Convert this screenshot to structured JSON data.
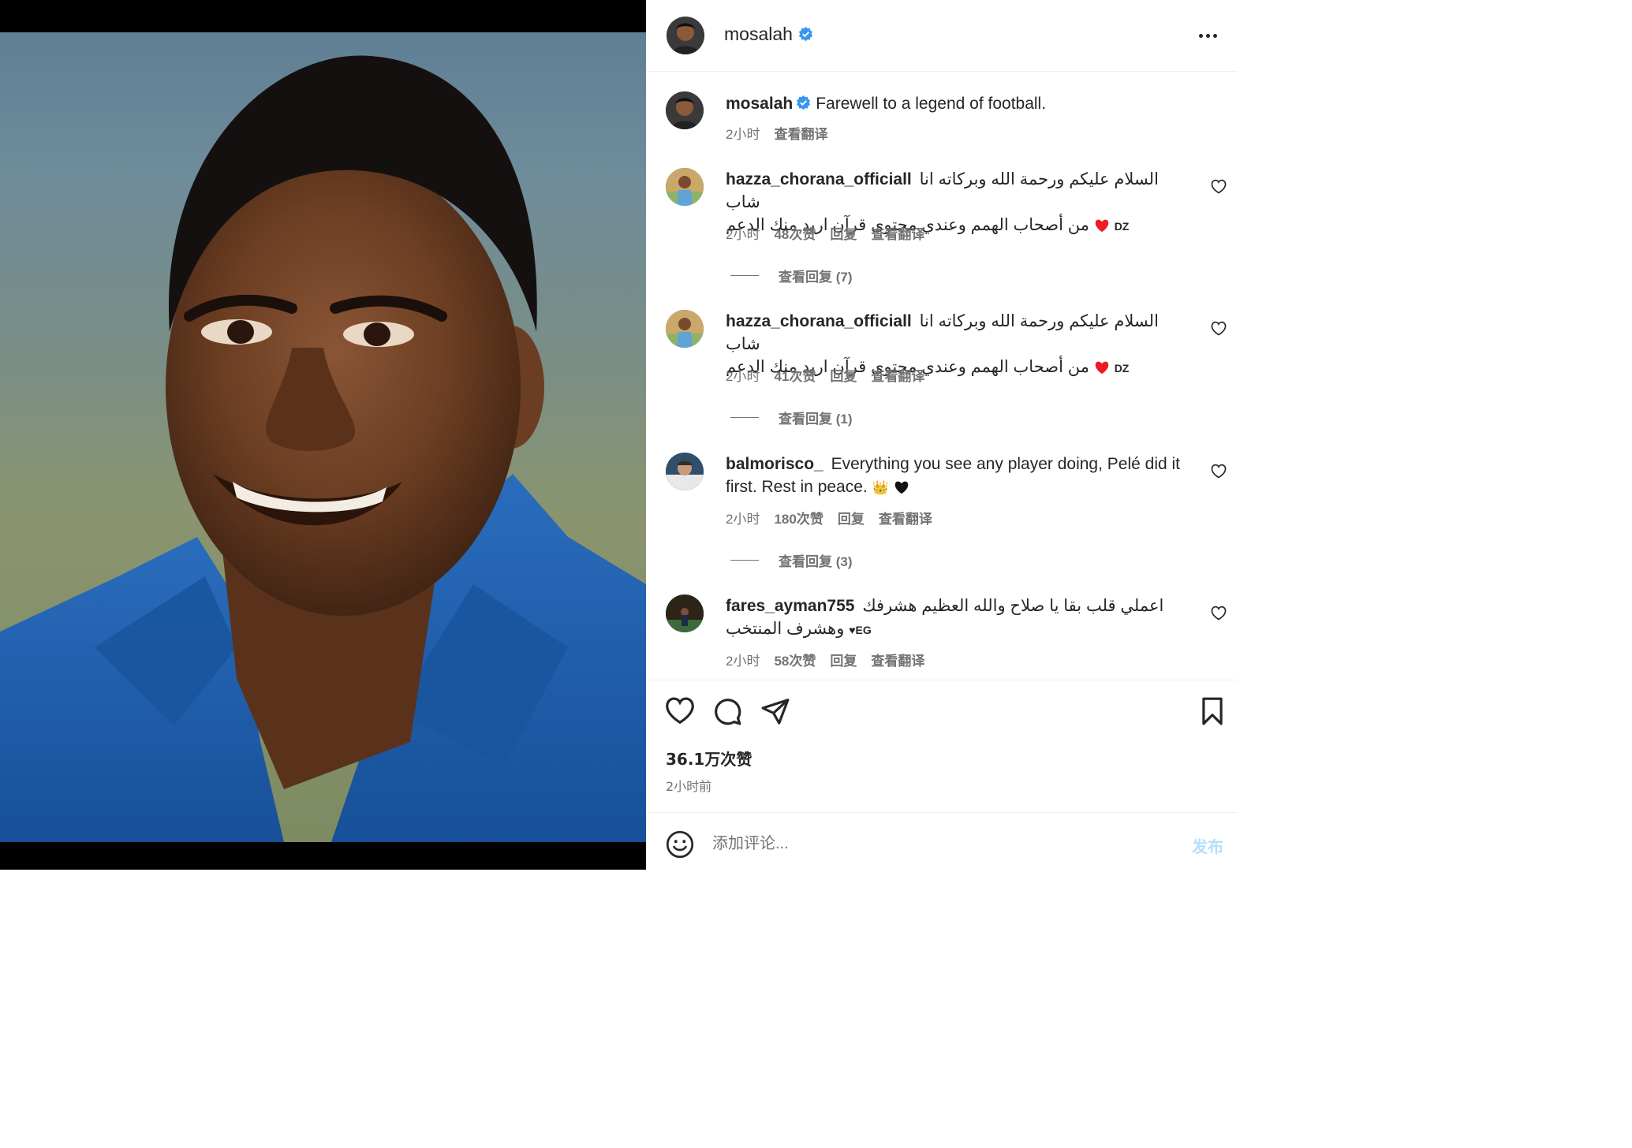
{
  "post": {
    "author": "mosalah",
    "verified": true,
    "caption": "Farewell to a legend of football.",
    "caption_time": "2小时",
    "caption_translate": "查看翻译",
    "photo_icon": "portrait-photo"
  },
  "comments": [
    {
      "username": "hazza_chorana_officiall",
      "text_line1": "السلام عليكم ورحمة الله وبركاته انا شاب",
      "text_line2": "من أصحاب الهمم وعندي محتوى قرآن اريد منك الدعم",
      "suffix": "DZ",
      "time": "2小时",
      "likes": "48次赞",
      "reply": "回复",
      "translate": "查看翻译",
      "view_replies": "查看回复 (7)"
    },
    {
      "username": "hazza_chorana_officiall",
      "text_line1": "السلام عليكم ورحمة الله وبركاته انا شاب",
      "text_line2": "من أصحاب الهمم وعندي محتوى قرآن اريد منك الدعم",
      "suffix": "DZ",
      "time": "2小时",
      "likes": "41次赞",
      "reply": "回复",
      "translate": "查看翻译",
      "view_replies": "查看回复 (1)"
    },
    {
      "username": "balmorisco_",
      "text": "Everything you see any player doing, Pelé did it first. Rest in peace.",
      "emoji1": "👑",
      "time": "2小时",
      "likes": "180次赞",
      "reply": "回复",
      "translate": "查看翻译",
      "view_replies": "查看回复 (3)"
    },
    {
      "username": "fares_ayman755",
      "text_line1": "اعملي قلب بقا يا صلاح والله العظيم هشرفك",
      "text_line2": "وهشرف المنتخب",
      "suffix": "♥EG",
      "time": "2小时",
      "likes": "58次赞",
      "reply": "回复",
      "translate": "查看翻译"
    }
  ],
  "footer": {
    "likes_count": "36.1万次赞",
    "posted_time": "2小时前",
    "comment_placeholder": "添加评论...",
    "post_button": "发布"
  },
  "icons": [
    "more-icon",
    "verified-icon",
    "heart-icon",
    "comment-icon",
    "share-icon",
    "bookmark-icon",
    "emoji-icon"
  ],
  "colors": {
    "accent": "#0095f6",
    "verified": "#3897f0",
    "post_disabled": "#b2dffc",
    "heart_red": "#ed1c24",
    "jersey_blue": "#1f5fae"
  }
}
